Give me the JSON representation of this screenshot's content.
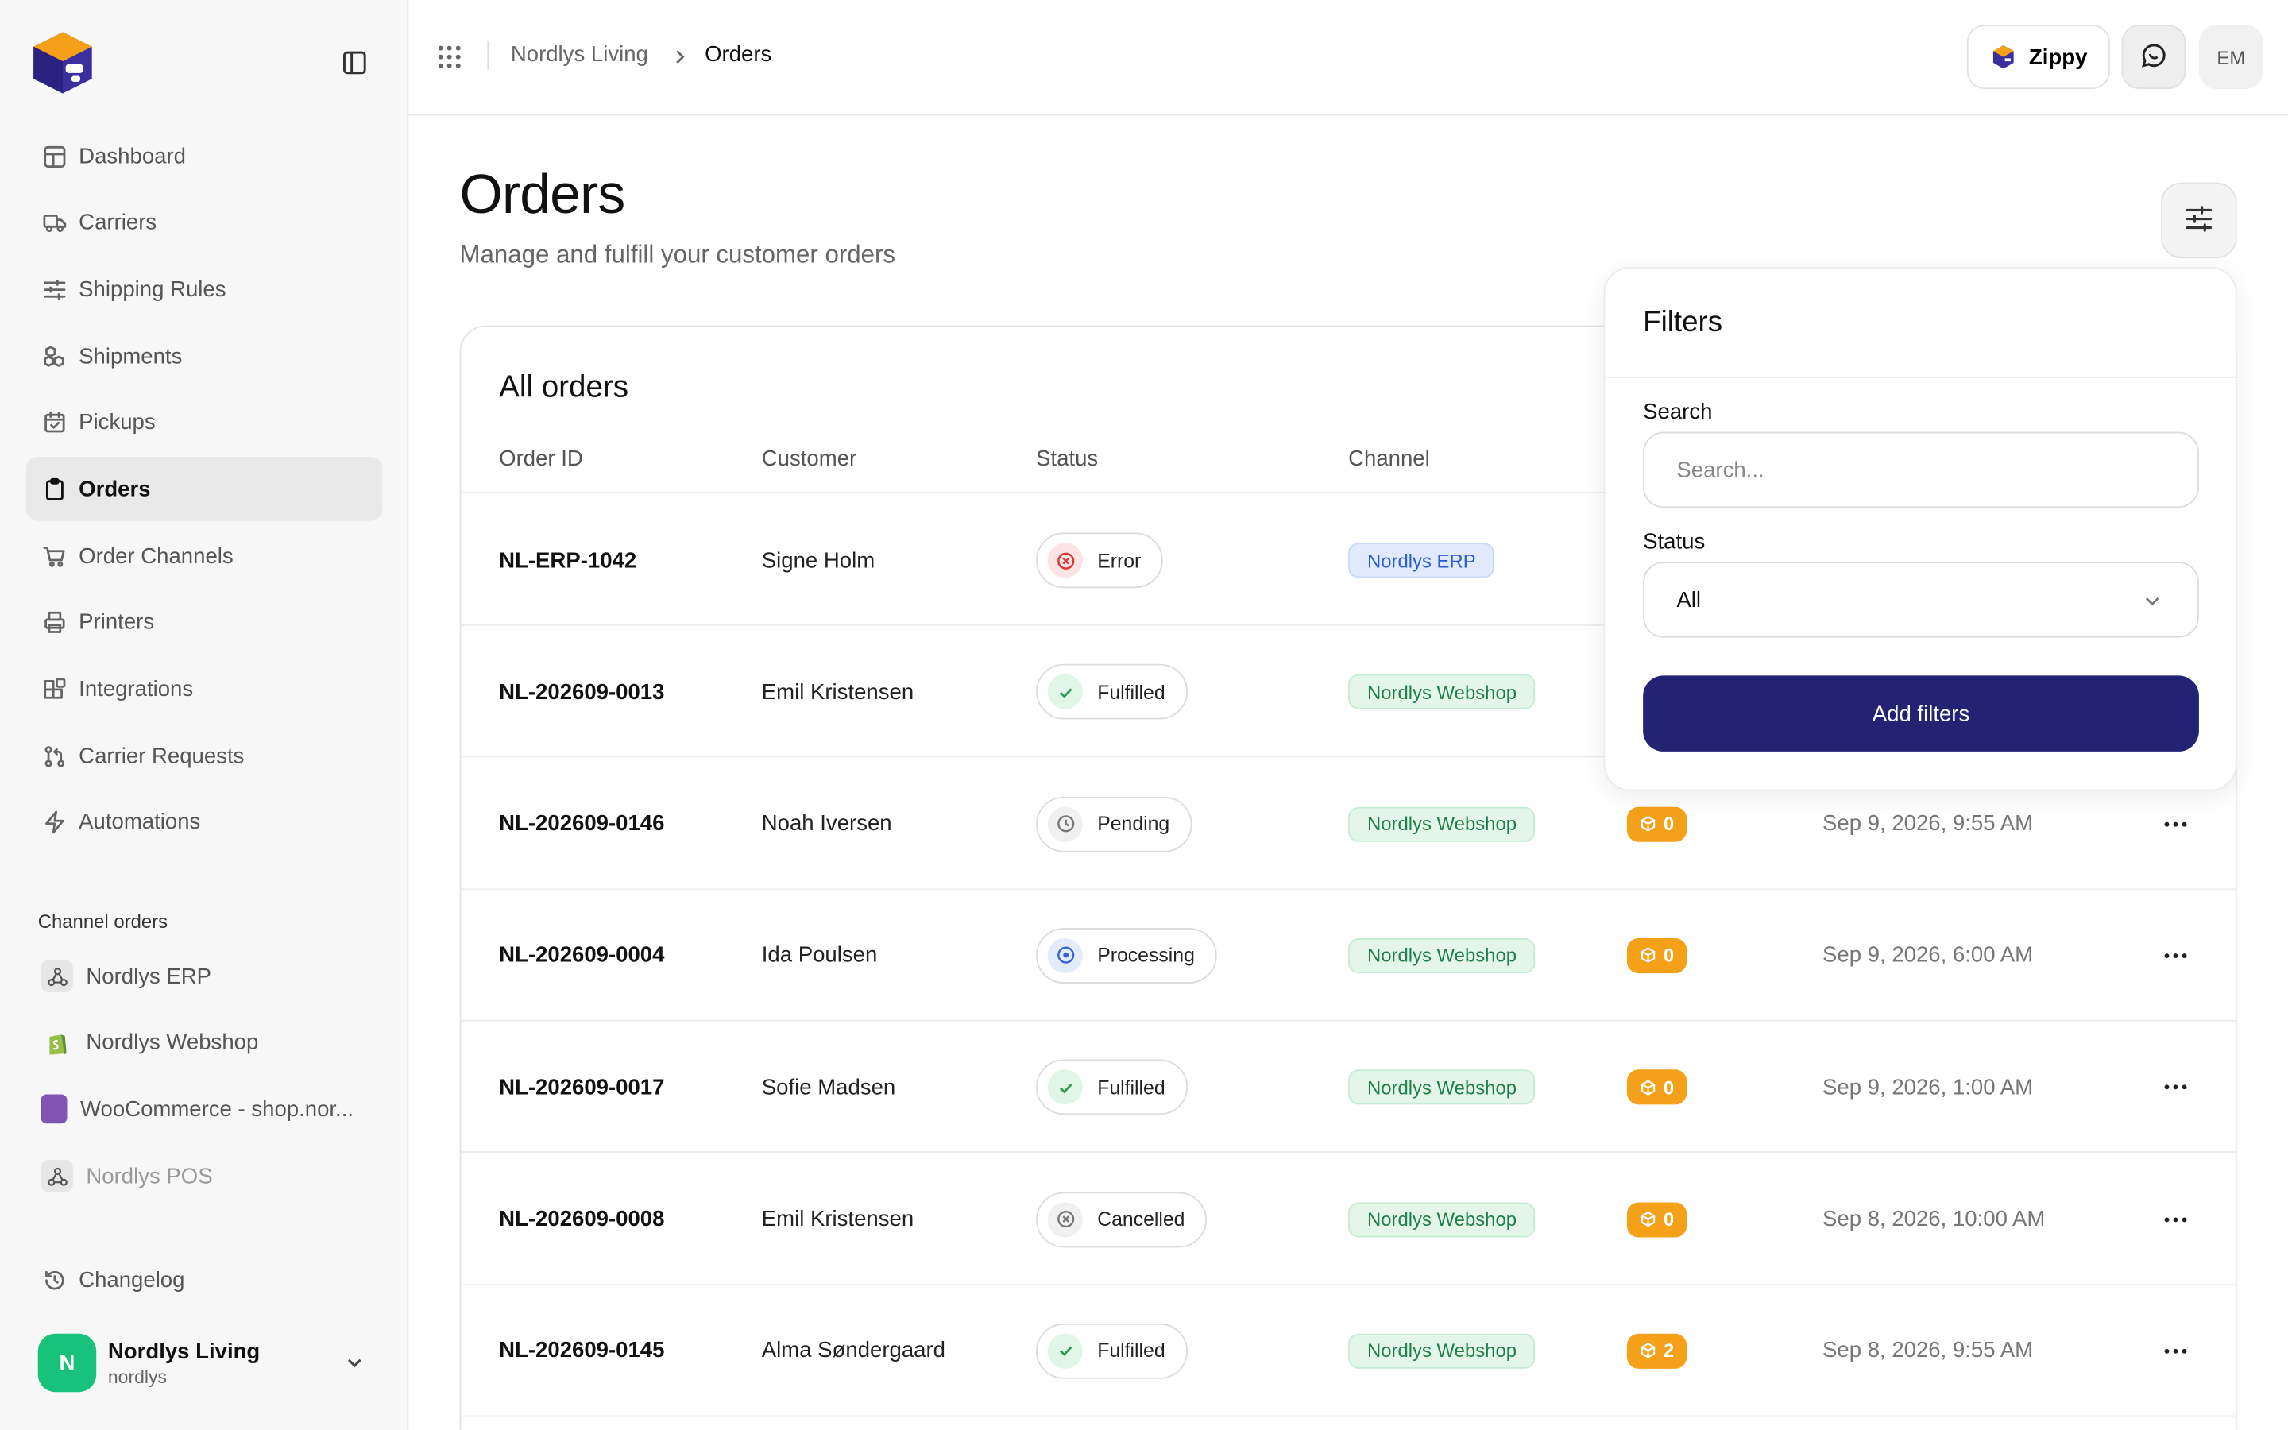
{
  "sidebar": {
    "nav": [
      {
        "label": "Dashboard",
        "icon": "layout-dashboard-icon"
      },
      {
        "label": "Carriers",
        "icon": "truck-icon"
      },
      {
        "label": "Shipping Rules",
        "icon": "sliders-icon"
      },
      {
        "label": "Shipments",
        "icon": "boxes-icon"
      },
      {
        "label": "Pickups",
        "icon": "calendar-check-icon"
      },
      {
        "label": "Orders",
        "icon": "clipboard-icon",
        "active": true
      },
      {
        "label": "Order Channels",
        "icon": "cart-icon"
      },
      {
        "label": "Printers",
        "icon": "printer-icon"
      },
      {
        "label": "Integrations",
        "icon": "blocks-icon"
      },
      {
        "label": "Carrier Requests",
        "icon": "git-pull-request-icon"
      },
      {
        "label": "Automations",
        "icon": "zap-icon"
      }
    ],
    "section_label": "Channel orders",
    "channels": [
      {
        "label": "Nordlys ERP",
        "icon": "webhook-icon"
      },
      {
        "label": "Nordlys Webshop",
        "icon": "shopify-icon"
      },
      {
        "label": "WooCommerce - shop.nor...",
        "icon": "woocommerce-icon"
      },
      {
        "label": "Nordlys POS",
        "icon": "webhook-icon",
        "faded": true
      }
    ],
    "changelog": "Changelog",
    "account": {
      "initial": "N",
      "name": "Nordlys Living",
      "slug": "nordlys"
    }
  },
  "topbar": {
    "breadcrumb": [
      "Nordlys Living",
      "Orders"
    ],
    "assistant_label": "Zippy",
    "user_initials": "EM"
  },
  "page": {
    "title": "Orders",
    "subtitle": "Manage and fulfill your customer orders"
  },
  "table": {
    "title": "All orders",
    "columns": [
      "Order ID",
      "Customer",
      "Status",
      "Channel"
    ],
    "rows": [
      {
        "id": "NL-ERP-1042",
        "customer": "Signe Holm",
        "status": "Error",
        "status_kind": "error",
        "channel": "Nordlys ERP",
        "channel_kind": "erp",
        "count": "",
        "date": ""
      },
      {
        "id": "NL-202609-0013",
        "customer": "Emil Kristensen",
        "status": "Fulfilled",
        "status_kind": "ok",
        "channel": "Nordlys Webshop",
        "channel_kind": "web",
        "count": "",
        "date": ""
      },
      {
        "id": "NL-202609-0146",
        "customer": "Noah Iversen",
        "status": "Pending",
        "status_kind": "pending",
        "channel": "Nordlys Webshop",
        "channel_kind": "web",
        "count": "0",
        "date": "Sep 9, 2026, 9:55 AM"
      },
      {
        "id": "NL-202609-0004",
        "customer": "Ida Poulsen",
        "status": "Processing",
        "status_kind": "processing",
        "channel": "Nordlys Webshop",
        "channel_kind": "web",
        "count": "0",
        "date": "Sep 9, 2026, 6:00 AM"
      },
      {
        "id": "NL-202609-0017",
        "customer": "Sofie Madsen",
        "status": "Fulfilled",
        "status_kind": "ok",
        "channel": "Nordlys Webshop",
        "channel_kind": "web",
        "count": "0",
        "date": "Sep 9, 2026, 1:00 AM"
      },
      {
        "id": "NL-202609-0008",
        "customer": "Emil Kristensen",
        "status": "Cancelled",
        "status_kind": "cancelled",
        "channel": "Nordlys Webshop",
        "channel_kind": "web",
        "count": "0",
        "date": "Sep 8, 2026, 10:00 AM"
      },
      {
        "id": "NL-202609-0145",
        "customer": "Alma Søndergaard",
        "status": "Fulfilled",
        "status_kind": "ok",
        "channel": "Nordlys Webshop",
        "channel_kind": "web",
        "count": "2",
        "date": "Sep 8, 2026, 9:55 AM"
      }
    ]
  },
  "filters": {
    "title": "Filters",
    "search_label": "Search",
    "search_placeholder": "Search...",
    "status_label": "Status",
    "status_value": "All",
    "submit_label": "Add filters"
  },
  "colors": {
    "primary_button": "#232374",
    "active_nav_bg": "#e9e9e9",
    "count_badge": "#f5a019",
    "account_avatar": "#18c27a"
  }
}
